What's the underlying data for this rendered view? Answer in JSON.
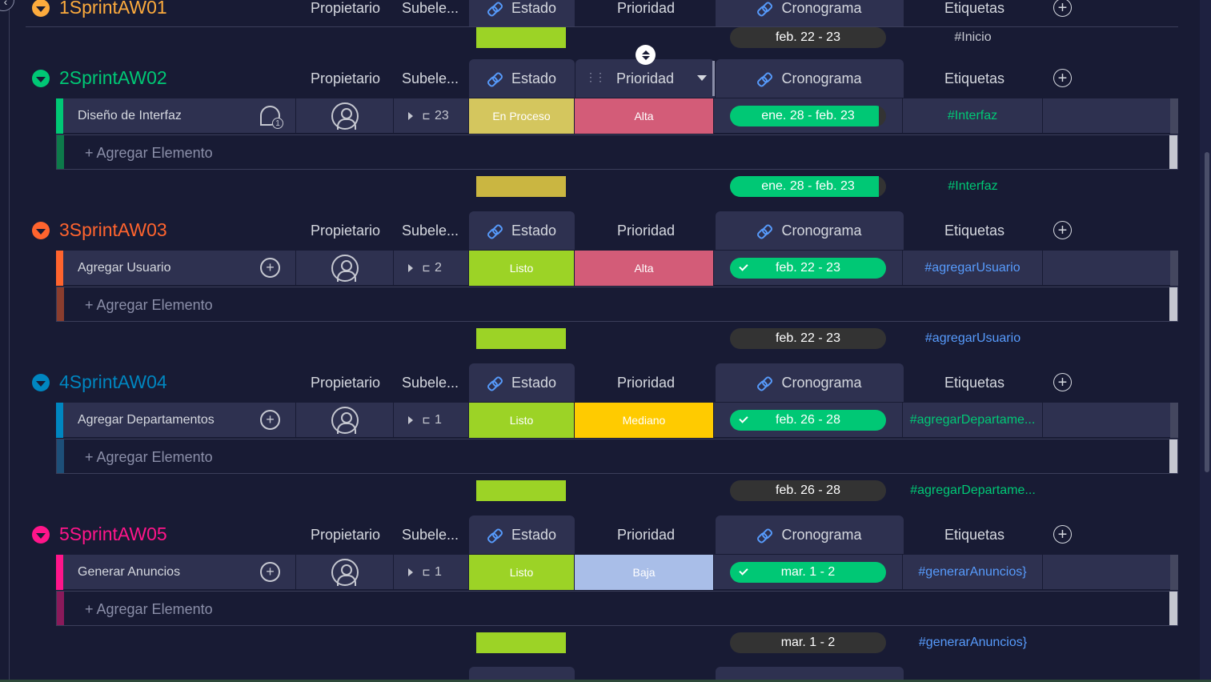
{
  "groups": [
    {
      "title": "1SprintAW01",
      "color": "#fdab3d",
      "columns": {
        "owner": "Propietario",
        "sub": "Subele...",
        "status": "Estado",
        "priority": "Prioridad",
        "timeline": "Cronograma",
        "tags": "Etiquetas"
      }
    },
    {
      "title": "2SprintAW02",
      "color": "#00c875",
      "columns": {
        "owner": "Propietario",
        "sub": "Subele...",
        "status": "Estado",
        "priority": "Prioridad",
        "timeline": "Cronograma",
        "tags": "Etiquetas"
      },
      "item": {
        "name": "Diseño de Interfaz",
        "updates": "1",
        "subitems": "23",
        "status": "En Proceso",
        "priority": "Alta",
        "timeline": "ene. 28 - feb. 23",
        "tag": "#Interfaz"
      },
      "add_label": "+ Agregar Elemento"
    },
    {
      "title": "3SprintAW03",
      "color": "#ff642e",
      "columns": {
        "owner": "Propietario",
        "sub": "Subele...",
        "status": "Estado",
        "priority": "Prioridad",
        "timeline": "Cronograma",
        "tags": "Etiquetas"
      },
      "item": {
        "name": "Agregar Usuario",
        "subitems": "2",
        "status": "Listo",
        "priority": "Alta",
        "timeline": "feb. 22 - 23",
        "tag": "#agregarUsuario"
      },
      "add_label": "+ Agregar Elemento"
    },
    {
      "title": "4SprintAW04",
      "color": "#0086c0",
      "columns": {
        "owner": "Propietario",
        "sub": "Subele...",
        "status": "Estado",
        "priority": "Prioridad",
        "timeline": "Cronograma",
        "tags": "Etiquetas"
      },
      "item": {
        "name": "Agregar Departamentos",
        "subitems": "1",
        "status": "Listo",
        "priority": "Mediano",
        "timeline": "feb. 26 - 28",
        "tag": "#agregarDepartame..."
      },
      "add_label": "+ Agregar Elemento"
    },
    {
      "title": "5SprintAW05",
      "color": "#ff158a",
      "columns": {
        "owner": "Propietario",
        "sub": "Subele...",
        "status": "Estado",
        "priority": "Prioridad",
        "timeline": "Cronograma",
        "tags": "Etiquetas"
      },
      "item": {
        "name": "Generar Anuncios",
        "subitems": "1",
        "status": "Listo",
        "priority": "Baja",
        "timeline": "mar. 1 - 2",
        "tag": "#generarAnuncios}"
      },
      "add_label": "+ Agregar Elemento"
    }
  ],
  "summaries": [
    {
      "timeline": "feb. 22 - 23",
      "tag": "#Inicio",
      "tag_color": "#c5c7d0",
      "bar_color": "#9cd326",
      "pill_fill": "0"
    },
    {
      "timeline": "ene. 28 - feb. 23",
      "tag": "#Interfaz",
      "tag_color": "#00c875",
      "bar_color": "#cab641",
      "pill_fill": "0.95"
    },
    {
      "timeline": "feb. 22 - 23",
      "tag": "#agregarUsuario",
      "tag_color": "#579bfc",
      "bar_color": "#9cd326",
      "pill_fill": "0"
    },
    {
      "timeline": "feb. 26 - 28",
      "tag": "#agregarDepartame...",
      "tag_color": "#00c875",
      "bar_color": "#9cd326",
      "pill_fill": "0"
    },
    {
      "timeline": "mar. 1 - 2",
      "tag": "#generarAnuncios}",
      "tag_color": "#579bfc",
      "bar_color": "#9cd326",
      "pill_fill": "0"
    }
  ],
  "colors": {
    "status_en_proceso": "#d4c65e",
    "status_listo": "#9cd326",
    "priority_alta": "#d35c78",
    "priority_mediano": "#ffcb00",
    "priority_baja": "#a9bee8",
    "timeline_done": "#00c875",
    "tag_green": "#00c875",
    "tag_blue": "#579bfc"
  },
  "icons": [
    "chevron-left-icon",
    "link-icon",
    "plus-circle-icon",
    "chat-icon",
    "add-update-icon",
    "person-icon",
    "caret-right-icon",
    "subitems-icon",
    "check-icon",
    "sort-icon",
    "drag-handle-icon"
  ]
}
